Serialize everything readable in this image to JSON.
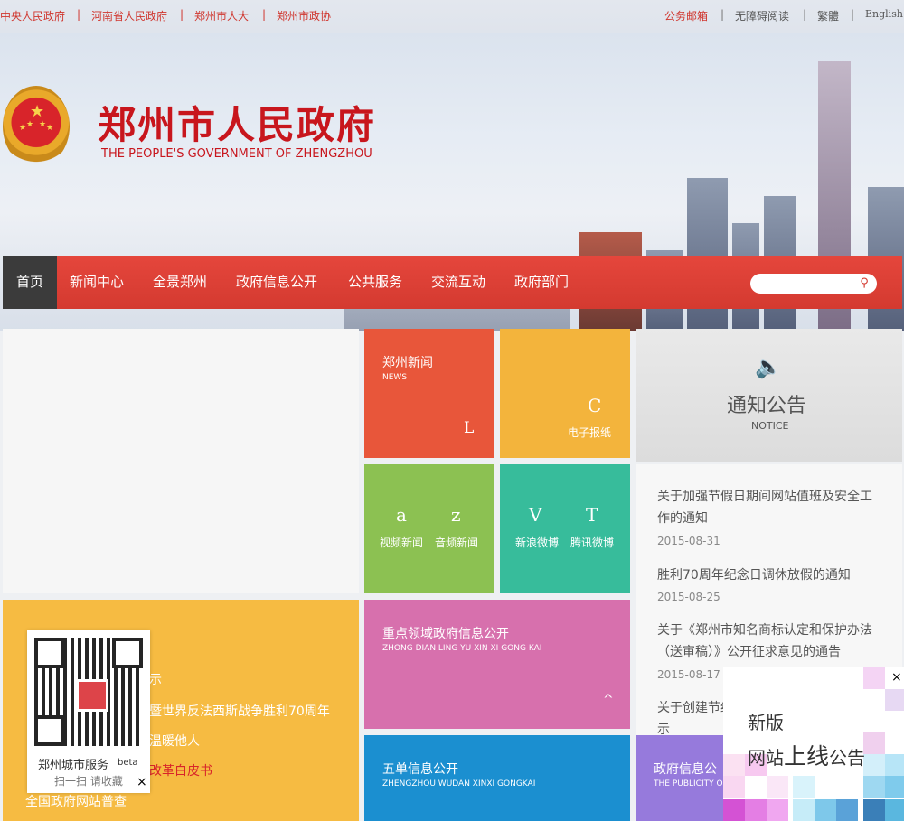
{
  "top_links_left": [
    "中央人民政府",
    "河南省人民政府",
    "郑州市人大",
    "郑州市政协"
  ],
  "top_links_right": [
    "公务邮箱",
    "无障碍阅读",
    "繁體",
    "English"
  ],
  "site": {
    "title": "郑州市人民政府",
    "subtitle": "THE PEOPLE'S GOVERNMENT OF ZHENGZHOU"
  },
  "nav": [
    "首页",
    "新闻中心",
    "全景郑州",
    "政府信息公开",
    "公共服务",
    "交流互动",
    "政府部门"
  ],
  "tiles": {
    "news": {
      "title": "郑州新闻",
      "en": "NEWS",
      "glyph": "L"
    },
    "epaper": {
      "glyph": "C",
      "label": "电子报纸"
    },
    "video": {
      "glyph": "a",
      "label": "视频新闻"
    },
    "audio": {
      "glyph": "z",
      "label": "音频新闻"
    },
    "sina": {
      "glyph": "V",
      "label": "新浪微博"
    },
    "tencent": {
      "glyph": "T",
      "label": "腾讯微博"
    },
    "key_info": {
      "title": "重点领域政府信息公开",
      "en": "ZHONG DIAN LING YU XIN XI GONG KAI",
      "caret": "^"
    },
    "wudan": {
      "title": "五单信息公开",
      "en": "ZHENGZHOU WUDAN XINXI GONGKAI"
    },
    "gov_info": {
      "title": "政府信息公",
      "en": "THE PUBLICITY O"
    }
  },
  "notice": {
    "title": "通知公告",
    "en": "NOTICE",
    "items": [
      {
        "text": "关于加强节假日期间网站值班及安全工作的通知",
        "date": "2015-08-31"
      },
      {
        "text": "胜利70周年纪念日调休放假的通知",
        "date": "2015-08-25"
      },
      {
        "text": "关于《郑州市知名商标认定和保护办法（送审稿）》公开征求意见的通告",
        "date": "2015-08-17"
      },
      {
        "text": "关于创建节约",
        "date": ""
      }
    ],
    "tail": "示"
  },
  "yellow_list": [
    "示",
    "暨世界反法西斯战争胜利70周年",
    "温暖他人",
    "改革白皮书",
    "全国政府网站普查"
  ],
  "qr": {
    "title": "郑州城市服务",
    "beta": "beta",
    "hint": "扫一扫 请收藏",
    "close": "×"
  },
  "popup": {
    "line1": "新版",
    "line2_a": "网站",
    "line2_b": "上线",
    "line2_c": "公告",
    "close": "×"
  },
  "colors": {
    "nav": "#d43a30",
    "news": "#e8563a",
    "epaper": "#f3b43c",
    "green": "#8cc152",
    "teal": "#37bc9b",
    "pink": "#d770ad",
    "blue": "#1b8fd0",
    "purple": "#967adc",
    "yellow": "#f6bb42"
  }
}
